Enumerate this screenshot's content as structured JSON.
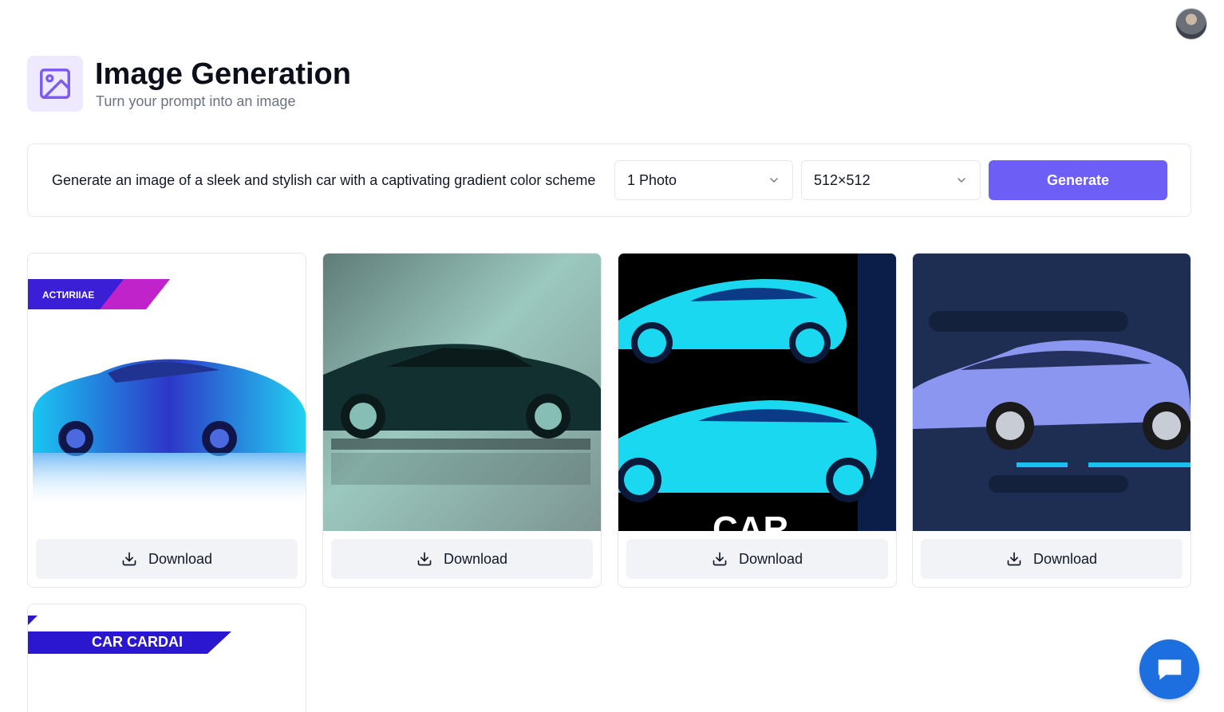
{
  "header": {
    "title": "Image Generation",
    "subtitle": "Turn your prompt into an image",
    "icon": "image-icon",
    "accent_color": "#7c5cf0"
  },
  "form": {
    "prompt_value": "Generate an image of a sleek and stylish car with a captivating gradient color scheme",
    "amount_selected": "1 Photo",
    "resolution_selected": "512×512",
    "generate_label": "Generate",
    "generate_color": "#6d5ff6"
  },
  "images": [
    {
      "banner_text": "ACTИRIIAE",
      "download_label": "Download"
    },
    {
      "download_label": "Download"
    },
    {
      "overlay_text": "CAR",
      "download_label": "Download"
    },
    {
      "download_label": "Download"
    },
    {
      "banner_text": "CAR CARDAI"
    }
  ],
  "chat": {
    "icon": "chat-icon",
    "color": "#1d6fe0"
  }
}
